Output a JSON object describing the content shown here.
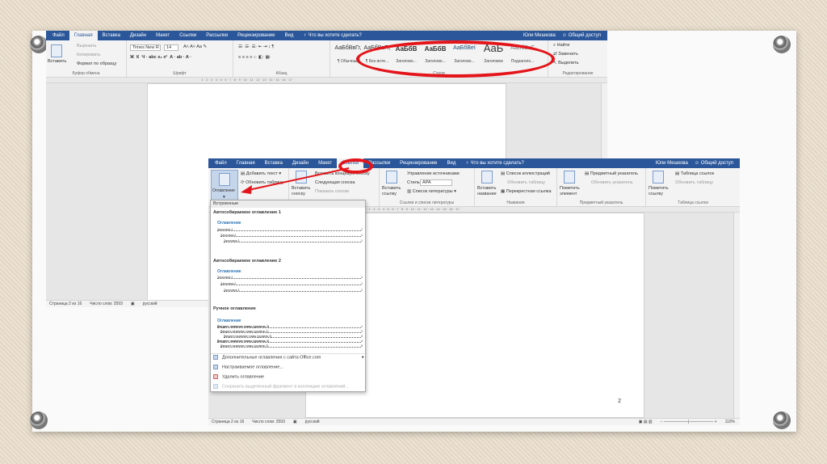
{
  "win1": {
    "tabs": [
      "Файл",
      "Главная",
      "Вставка",
      "Дизайн",
      "Макет",
      "Ссылки",
      "Рассылки",
      "Рецензирование",
      "Вид"
    ],
    "tellme": "Что вы хотите сделать?",
    "user": "Юли Мешкова",
    "share": "Общий доступ",
    "clipboard": {
      "paste": "Вставить",
      "cut": "Вырезать",
      "copy": "Копировать",
      "format": "Формат по образцу",
      "label": "Буфер обмена"
    },
    "font": {
      "name": "Times New R",
      "size": "14",
      "label": "Шрифт"
    },
    "paragraph": {
      "label": "Абзац"
    },
    "styles": {
      "label": "Стили",
      "items": [
        {
          "sample": "АаБбВвГг,",
          "name": "¶ Обычный"
        },
        {
          "sample": "АаБбВвГг,",
          "name": "¶ Без инте..."
        },
        {
          "sample": "АаБбВ",
          "name": "Заголово..."
        },
        {
          "sample": "АаБбВ",
          "name": "Заголово..."
        },
        {
          "sample": "АаБбВеІ",
          "name": "Заголово..."
        },
        {
          "sample": "АаЬ",
          "name": "Заголовок"
        },
        {
          "sample": "АаБбВвГ",
          "name": "Подзаголо..."
        }
      ]
    },
    "editing": {
      "find": "Найти",
      "replace": "Заменить",
      "select": "Выделить",
      "label": "Редактирование"
    },
    "status": {
      "page": "Страница 2 из 16",
      "words": "Число слов: 2593",
      "lang": "русский"
    }
  },
  "win2": {
    "tabs": [
      "Файл",
      "Главная",
      "Вставка",
      "Дизайн",
      "Макет",
      "Ссылки",
      "Рассылки",
      "Рецензирование",
      "Вид"
    ],
    "tellme": "Что вы хотите сделать?",
    "user": "Юли Мешкова",
    "share": "Общий доступ",
    "toc": {
      "btn": "Оглавление",
      "add_text": "Добавить текст",
      "update": "Обновить таблицу"
    },
    "footnotes": {
      "insert": "Вставить сноску",
      "next": "Следующая сноска",
      "show": "Показать сноски",
      "endnote": "Вставить концевую сноску"
    },
    "citations": {
      "insert": "Вставить ссылку",
      "manage": "Управление источниками",
      "style_label": "Стиль:",
      "style": "APA",
      "biblio": "Список литературы",
      "label": "Ссылки и списки литературы"
    },
    "captions": {
      "insert": "Вставить название",
      "list": "Список иллюстраций",
      "update": "Обновить таблицу",
      "cross": "Перекрестная ссылка",
      "label": "Названия"
    },
    "index": {
      "mark": "Пометить элемент",
      "insert": "Предметный указатель",
      "update": "Обновить указатель",
      "label": "Предметный указатель"
    },
    "authorities": {
      "mark": "Пометить ссылку",
      "insert": "Таблица ссылок",
      "update": "Обновить таблицу",
      "label": "Таблица ссылок"
    },
    "page_number": "2",
    "status": {
      "page": "Страница 2 из 16",
      "words": "Число слов: 2593",
      "lang": "русский",
      "zoom": "110%"
    }
  },
  "dropdown": {
    "header": "Встроенные",
    "auto1": {
      "title": "Автособираемое оглавление 1",
      "toc": "Оглавление",
      "lines": [
        "Заголовок 1",
        "Заголовок 2",
        "Заголовок 3"
      ],
      "pages": [
        "1",
        "1",
        "1"
      ]
    },
    "auto2": {
      "title": "Автособираемое оглавление 2",
      "toc": "Оглавление",
      "lines": [
        "Заголовок 1",
        "Заголовок 2",
        "Заголовок 3"
      ],
      "pages": [
        "1",
        "1",
        "1"
      ]
    },
    "manual": {
      "title": "Ручное оглавление",
      "toc": "Оглавление",
      "lines": [
        "Введите название главы (уровень 1)",
        "Введите название главы (уровень 2)",
        "Введите название главы (уровень 3)",
        "Введите название главы (уровень 1)",
        "Введите название главы (уровень 2)"
      ],
      "pages": [
        "1",
        "2",
        "3",
        "4",
        "5"
      ]
    },
    "items": [
      "Дополнительные оглавления с сайта Office.com",
      "Настраиваемое оглавление...",
      "Удалить оглавление",
      "Сохранить выделенный фрагмент в коллекцию оглавлений..."
    ]
  }
}
